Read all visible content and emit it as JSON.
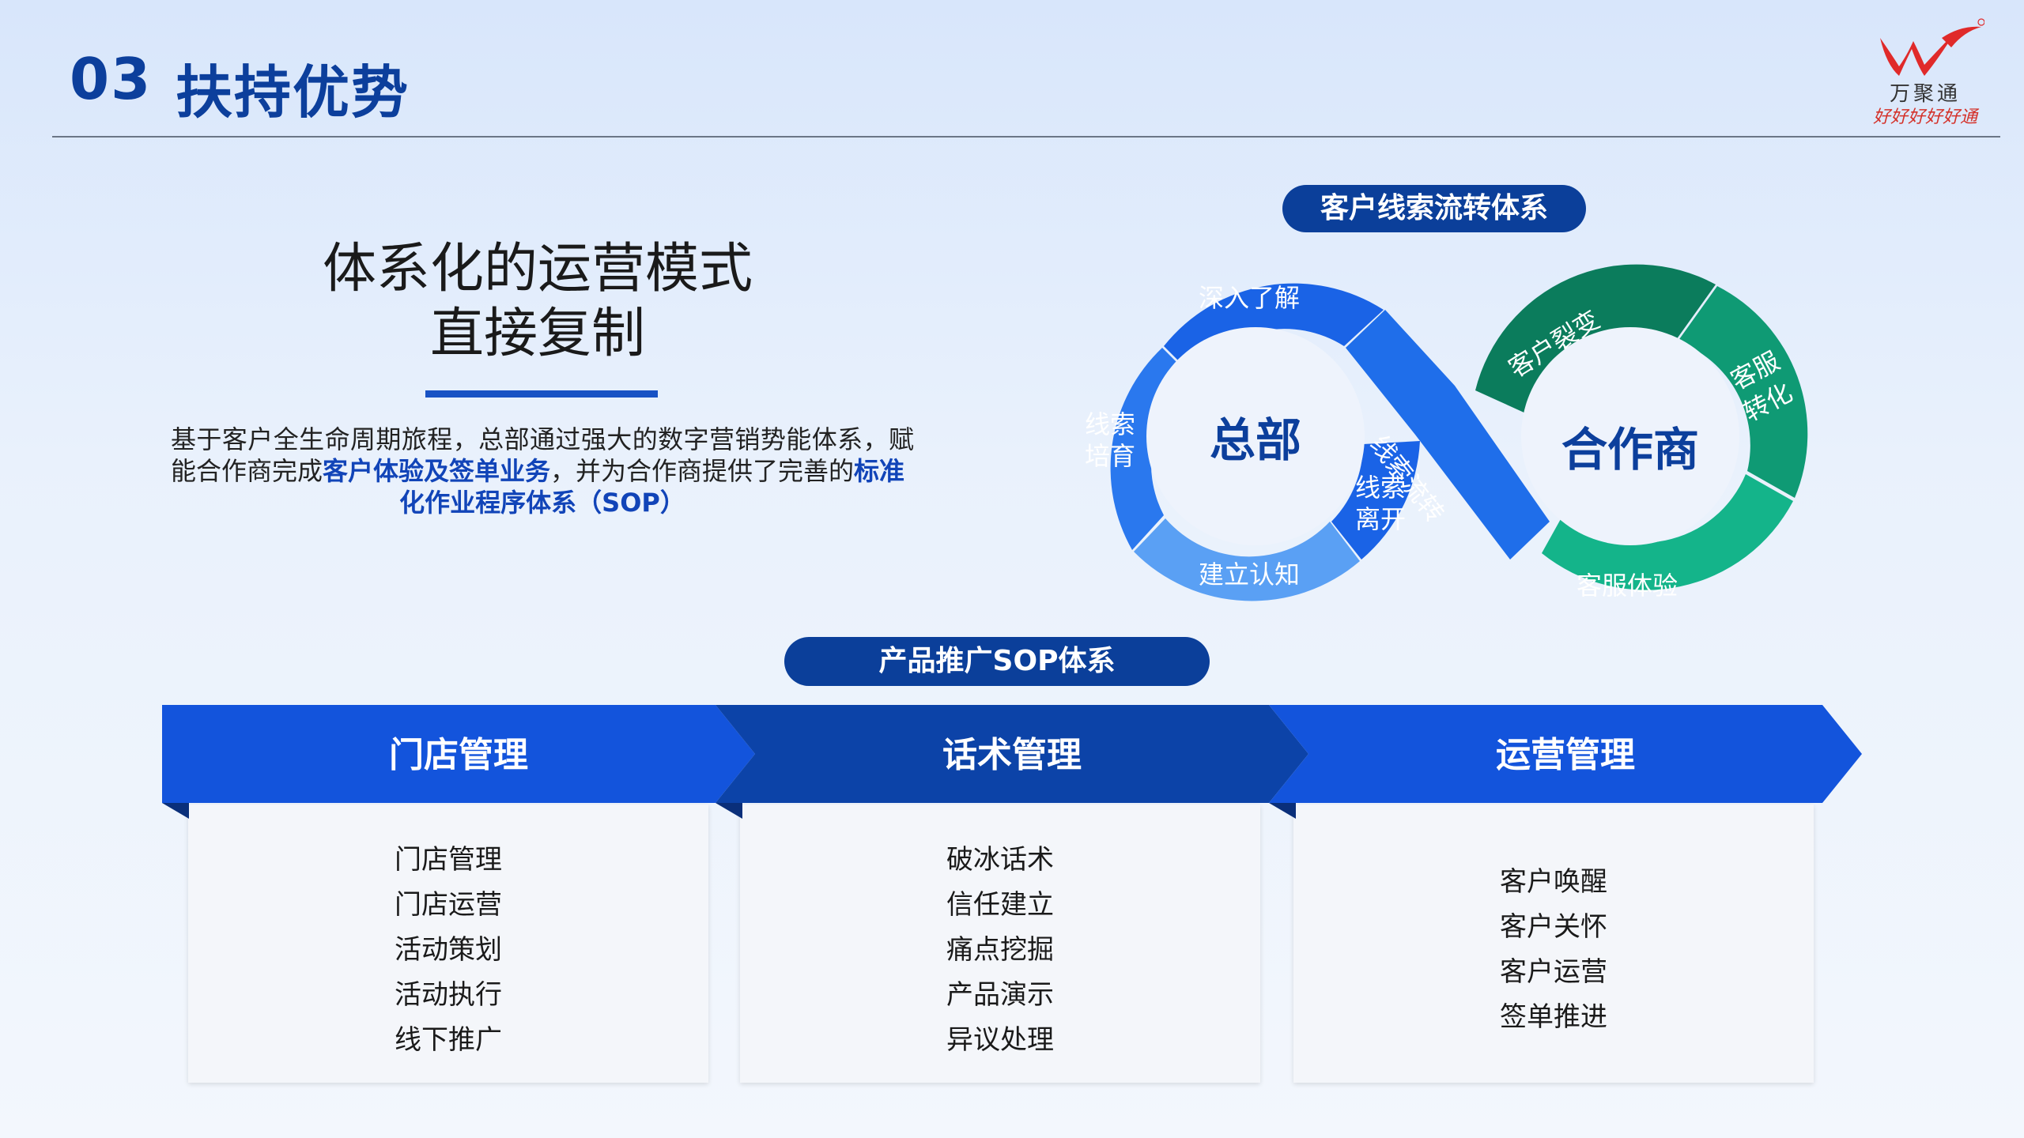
{
  "header": {
    "number": "03",
    "title": "扶持优势"
  },
  "logo": {
    "brand": "万聚通",
    "slogan": "好好好好好通"
  },
  "headline": {
    "line1": "体系化的运营模式",
    "line2": "直接复制"
  },
  "description": {
    "part1": "基于客户全生命周期旅程，总部通过强大的数字营销势能体系，赋能合作商完成",
    "highlight1": "客户体验及签单业务",
    "part2": "，并为合作商提供了完善的",
    "highlight2a": "标准",
    "highlight2b": "化作业程序体系（SOP）"
  },
  "lead_flow": {
    "title": "客户线索流转体系",
    "left_center": "总部",
    "right_center": "合作商",
    "left_segments": [
      "深入了解",
      "线索",
      "培育",
      "建立认知",
      "线索",
      "离开"
    ],
    "cross_label": "线索流转",
    "right_segments": [
      "客户裂变",
      "客服",
      "转化",
      "客服体验"
    ],
    "colors": {
      "blue_dark": "#1a5fe0",
      "blue_mid": "#2f7df0",
      "blue_light": "#5fa3f5",
      "green_dark": "#0b7a5a",
      "green_mid": "#0e9a74",
      "green_light": "#13b48a"
    }
  },
  "sop": {
    "title": "产品推广SOP体系",
    "columns": [
      {
        "label": "门店管理",
        "items": [
          "门店管理",
          "门店运营",
          "活动策划",
          "活动执行",
          "线下推广"
        ]
      },
      {
        "label": "话术管理",
        "items": [
          "破冰话术",
          "信任建立",
          "痛点挖掘",
          "产品演示",
          "异议处理"
        ]
      },
      {
        "label": "运营管理",
        "items": [
          "客户唤醒",
          "客户关怀",
          "客户运营",
          "签单推进"
        ]
      }
    ],
    "colors": {
      "band1": "#1354dc",
      "band2": "#0c43a8",
      "band3": "#1354dc",
      "fold": "#0a2f7a"
    }
  }
}
